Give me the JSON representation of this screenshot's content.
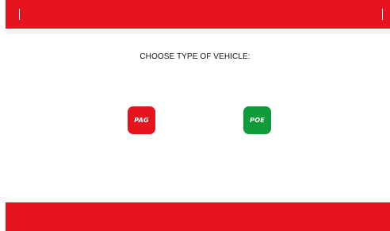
{
  "header": {},
  "main": {
    "title": "CHOOSE TYPE OF VEHICLE:",
    "buttons": [
      {
        "label": "PAG",
        "color": "#e5141f"
      },
      {
        "label": "POE",
        "color": "#0e9b3a"
      }
    ]
  },
  "colors": {
    "accent": "#e5141f",
    "background": "#ffffff"
  }
}
